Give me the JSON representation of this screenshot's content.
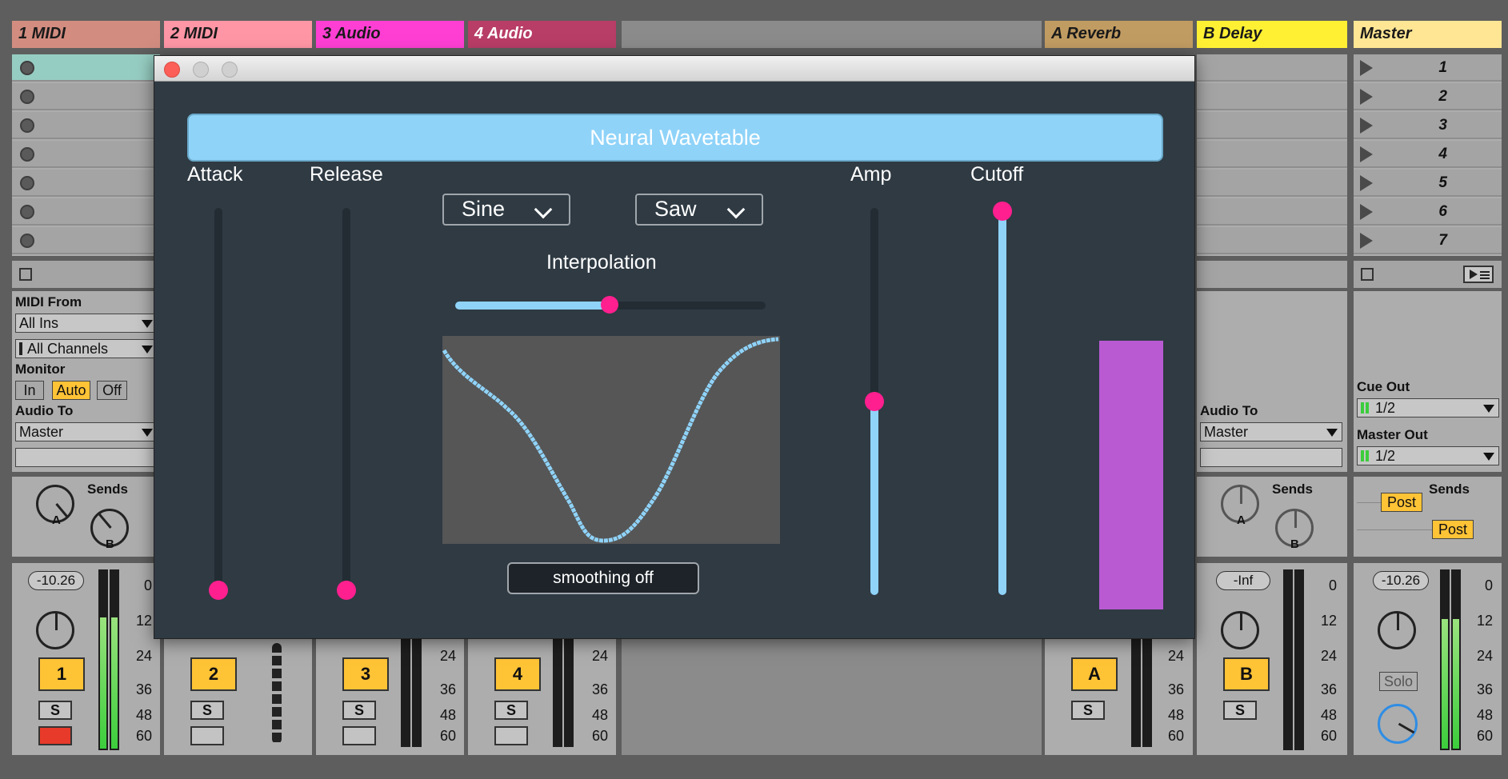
{
  "tracks": [
    {
      "name": "1 MIDI",
      "color": "#d28d80"
    },
    {
      "name": "2 MIDI",
      "color": "#ff96a6"
    },
    {
      "name": "3 Audio",
      "color": "#ff3fd4"
    },
    {
      "name": "4 Audio",
      "color": "#b83d67"
    },
    {
      "name": "A Reverb",
      "color": "#c19c62"
    },
    {
      "name": "B Delay",
      "color": "#fff034"
    },
    {
      "name": "Master",
      "color": "#ffe694"
    }
  ],
  "scenes": [
    "1",
    "2",
    "3",
    "4",
    "5",
    "6",
    "7"
  ],
  "io": {
    "midi_from_label": "MIDI From",
    "midi_from_value": "All Ins",
    "channel_value": "All Channels",
    "monitor_label": "Monitor",
    "monitor_in": "In",
    "monitor_auto": "Auto",
    "monitor_off": "Off",
    "audio_to_label": "Audio To",
    "audio_to_value": "Master",
    "cue_out_label": "Cue Out",
    "cue_out_value": "1/2",
    "master_out_label": "Master Out",
    "master_out_value": "1/2"
  },
  "sends": {
    "label": "Sends",
    "a": "A",
    "b": "B",
    "post": "Post"
  },
  "mixer": {
    "vol1": "-10.26",
    "volB": "-Inf",
    "volMaster": "-10.26",
    "ticks": [
      "0",
      "12",
      "24",
      "36",
      "48",
      "60"
    ],
    "track_nums": [
      "1",
      "2",
      "3",
      "4",
      "A",
      "B"
    ],
    "solo_label": "S",
    "master_solo": "Solo"
  },
  "plugin": {
    "title": "Neural Wavetable",
    "attack_label": "Attack",
    "release_label": "Release",
    "amp_label": "Amp",
    "cutoff_label": "Cutoff",
    "osc1": "Sine",
    "osc2": "Saw",
    "interpolation_label": "Interpolation",
    "smoothing_label": "smoothing off",
    "attack_value": 0.0,
    "release_value": 0.0,
    "amp_value": 0.5,
    "cutoff_value": 1.0,
    "interpolation_value": 0.5,
    "colors": {
      "accent": "#8fd3f9",
      "thumb": "#ff1f8e",
      "meter": "#b95ad3",
      "bg": "#2f3a43"
    }
  }
}
